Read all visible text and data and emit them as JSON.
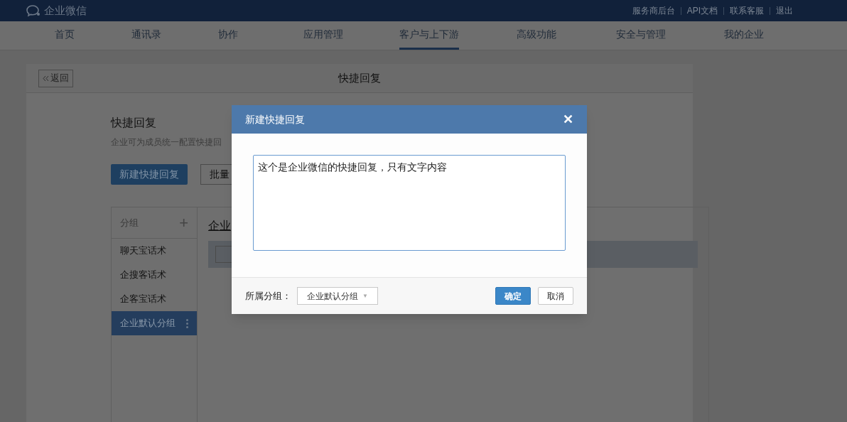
{
  "topbar": {
    "brand": "企业微信",
    "links": [
      "服务商后台",
      "API文档",
      "联系客服",
      "退出"
    ]
  },
  "nav": [
    {
      "label": "首页",
      "selected": false
    },
    {
      "label": "通讯录",
      "selected": false
    },
    {
      "label": "协作",
      "selected": false
    },
    {
      "label": "应用管理",
      "selected": false
    },
    {
      "label": "客户与上下游",
      "selected": true
    },
    {
      "label": "高级功能",
      "selected": false
    },
    {
      "label": "安全与管理",
      "selected": false
    },
    {
      "label": "我的企业",
      "selected": false
    }
  ],
  "page": {
    "back": "返回",
    "title": "快捷回复",
    "heading": "快捷回复",
    "description": "企业可为成员统一配置快捷回",
    "buttons": [
      "新建快捷回复",
      "批量"
    ]
  },
  "groups": {
    "header": "分组",
    "add": "+",
    "items": [
      {
        "label": "聊天宝话术",
        "selected": false
      },
      {
        "label": "企搜客话术",
        "selected": false
      },
      {
        "label": "企客宝话术",
        "selected": false
      },
      {
        "label": "企业默认分组",
        "selected": true
      }
    ]
  },
  "panel": {
    "title": "企业"
  },
  "dialog": {
    "title": "新建快捷回复",
    "close": "✕",
    "value": "这个是企业微信的快捷回复，只有文字内容",
    "group_label": "所属分组：",
    "group_value": "企业默认分组",
    "caret": "▼",
    "ok": "确定",
    "cancel": "取消"
  }
}
